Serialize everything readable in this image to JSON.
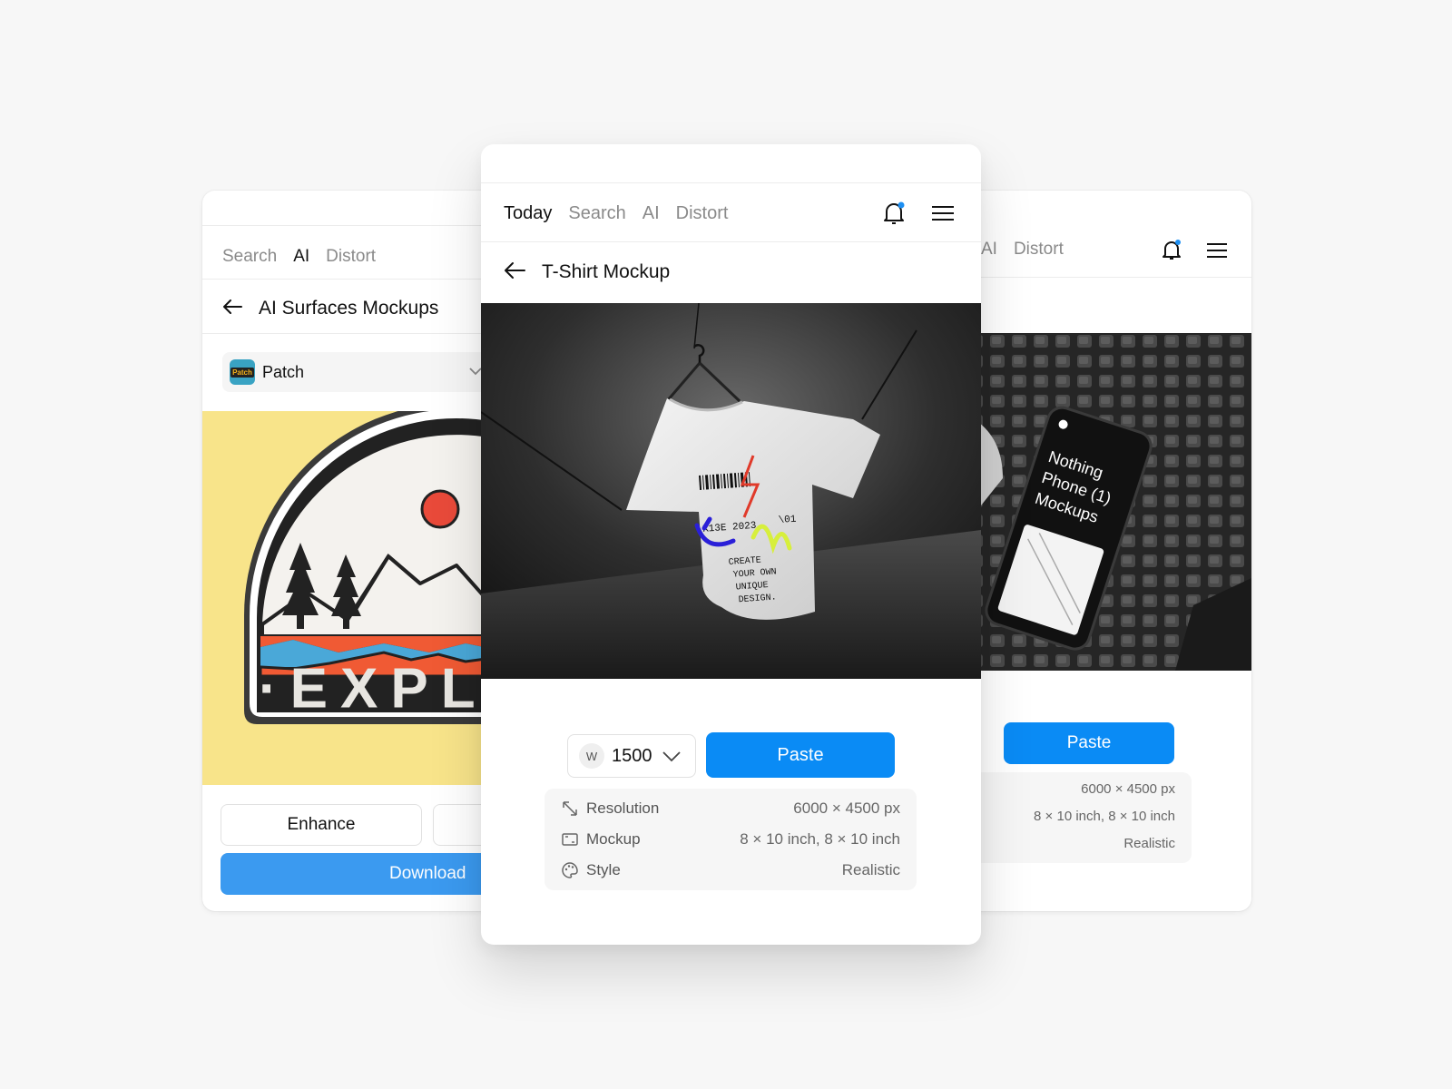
{
  "left_card": {
    "nav": [
      "Search",
      "AI",
      "Distort"
    ],
    "nav_active": 1,
    "title": "AI Surfaces Mockups",
    "select_label": "Patch",
    "select_icon_text": "Patch",
    "patch_text": "·EXPLO",
    "enhance_label": "Enhance",
    "download_label": "Download"
  },
  "center_card": {
    "nav": [
      "Today",
      "Search",
      "AI",
      "Distort"
    ],
    "nav_active": 0,
    "title": "T-Shirt Mockup",
    "width_prefix": "W",
    "width_value": "1500",
    "paste_label": "Paste",
    "info": [
      {
        "icon": "resolution-icon",
        "label": "Resolution",
        "value": "6000 × 4500 px"
      },
      {
        "icon": "frame-icon",
        "label": "Mockup",
        "value": "8 × 10 inch, 8 × 10 inch"
      },
      {
        "icon": "palette-icon",
        "label": "Style",
        "value": "Realistic"
      }
    ],
    "tshirt_print": {
      "barcode_num": "K13E 2023",
      "side": "\\01",
      "lines": [
        "CREATE",
        "YOUR OWN",
        "UNIQUE",
        "DESIGN."
      ]
    }
  },
  "right_card": {
    "nav": [
      "AI",
      "Distort"
    ],
    "phone_text": [
      "Nothing",
      "Phone (1)",
      "Mockups"
    ],
    "paste_label": "Paste",
    "info_values": [
      "6000 × 4500 px",
      "8 × 10 inch, 8 × 10 inch",
      "Realistic"
    ]
  },
  "colors": {
    "accent": "#0a8bf5",
    "download": "#3b9af0",
    "notification_dot": "#1d8ff2",
    "patch_bg": "#f8e48a"
  }
}
